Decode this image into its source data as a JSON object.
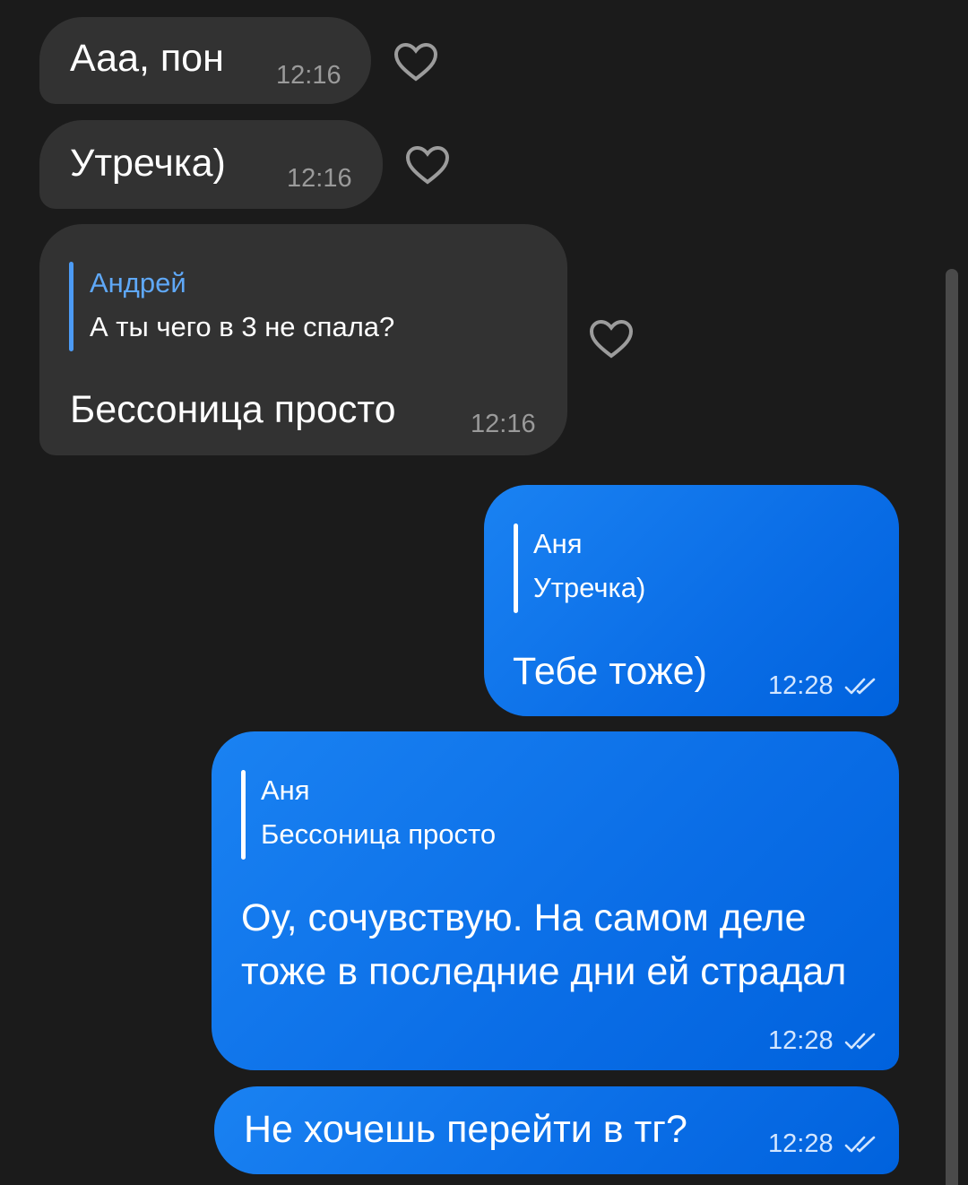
{
  "messages": [
    {
      "text": "Ааа, пон",
      "time": "12:16"
    },
    {
      "text": "Утречка)",
      "time": "12:16"
    },
    {
      "reply_name": "Андрей",
      "reply_text": "А ты чего в 3 не спала?",
      "text": "Бессоница просто",
      "time": "12:16"
    },
    {
      "reply_name": "Аня",
      "reply_text": "Утречка)",
      "text": "Тебе тоже)",
      "time": "12:28",
      "status": "read"
    },
    {
      "reply_name": "Аня",
      "reply_text": "Бессоница просто",
      "text": "Оу, сочувствую. На самом деле тоже в последние дни ей страдал",
      "time": "12:28",
      "status": "read"
    },
    {
      "text": "Не хочешь перейти в тг?",
      "time": "12:28",
      "status": "read"
    }
  ],
  "icons": {
    "like": "heart-outline-icon",
    "read_status": "double-check-icon"
  },
  "colors": {
    "background": "#1b1b1b",
    "incoming": "#323232",
    "outgoing": "#0a6de6",
    "reply_accent": "#4c9bf5"
  }
}
